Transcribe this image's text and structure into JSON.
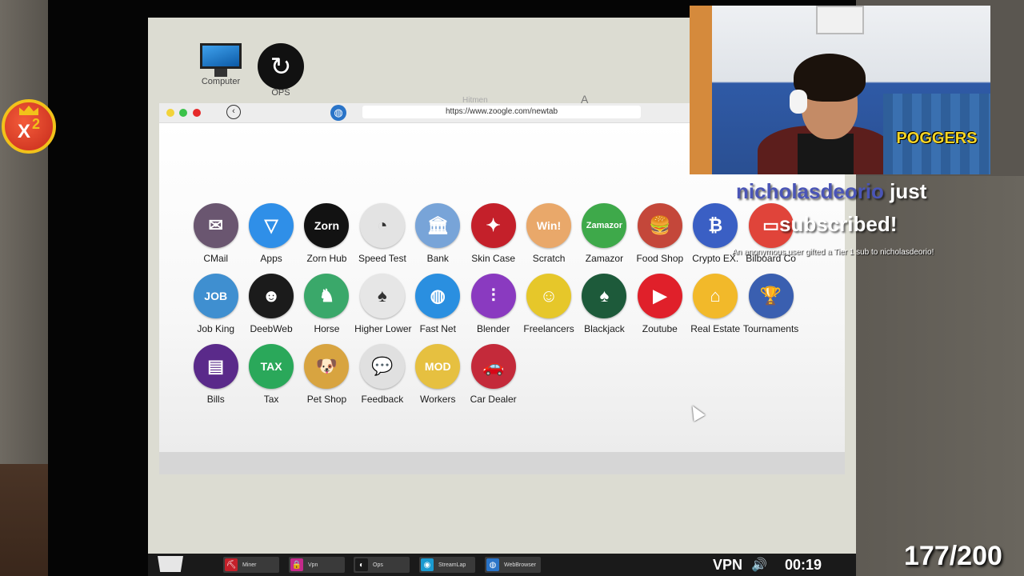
{
  "overlay": {
    "multiplier": {
      "symbol": "X",
      "value": "2"
    },
    "counter": "177/200",
    "alert": {
      "username": "nicholasdeorio",
      "line1_rest": "just",
      "line2": "subscribed!",
      "line3": "An anonymous user gifted a Tier 1 sub to nicholasdeorio!"
    },
    "webcam": {
      "sign": "POGGERS"
    }
  },
  "desktop": {
    "icons": [
      {
        "label": "Computer",
        "icon": "monitor-icon"
      },
      {
        "label": "OPS",
        "icon": "ops-icon"
      }
    ],
    "faded_labels": [
      "Hitmen",
      "A"
    ]
  },
  "browser": {
    "url": "https://www.zoogle.com/newtab",
    "back_glyph": "‹",
    "globe_glyph": "◍"
  },
  "apps": [
    {
      "label": "CMail",
      "bg": "#6a5670",
      "glyph": "✉"
    },
    {
      "label": "Apps",
      "bg": "#2f8fe8",
      "glyph": "▽"
    },
    {
      "label": "Zorn Hub",
      "bg": "#121212",
      "glyph": "Zorn"
    },
    {
      "label": "Speed Test",
      "bg": "#e3e3e3",
      "glyph": "◔"
    },
    {
      "label": "Bank",
      "bg": "#78a4d8",
      "glyph": "🏛"
    },
    {
      "label": "Skin Case",
      "bg": "#c4202a",
      "glyph": "✦"
    },
    {
      "label": "Scratch",
      "bg": "#e9a86a",
      "glyph": "Win!"
    },
    {
      "label": "Zamazor",
      "bg": "#3ea94a",
      "glyph": "Zamazor"
    },
    {
      "label": "Food Shop",
      "bg": "#c4473a",
      "glyph": "🍔"
    },
    {
      "label": "Crypto EX.",
      "bg": "#3a5fc4",
      "glyph": "₿"
    },
    {
      "label": "Bilboard Co",
      "bg": "#e0443a",
      "glyph": "▭"
    },
    {
      "label": "Job King",
      "bg": "#3f8fd0",
      "glyph": "JOB"
    },
    {
      "label": "DeebWeb",
      "bg": "#1b1b1b",
      "glyph": "☻"
    },
    {
      "label": "Horse",
      "bg": "#3aa86a",
      "glyph": "♞"
    },
    {
      "label": "Higher Lower",
      "bg": "#e6e6e6",
      "glyph": "♠"
    },
    {
      "label": "Fast Net",
      "bg": "#2a8fe0",
      "glyph": "◍"
    },
    {
      "label": "Blender",
      "bg": "#8a3ac0",
      "glyph": "⫶"
    },
    {
      "label": "Freelancers",
      "bg": "#e6c72a",
      "glyph": "☺"
    },
    {
      "label": "Blackjack",
      "bg": "#1d5a3a",
      "glyph": "♠"
    },
    {
      "label": "Zoutube",
      "bg": "#e0202a",
      "glyph": "▶"
    },
    {
      "label": "Real Estate",
      "bg": "#f2b92a",
      "glyph": "⌂"
    },
    {
      "label": "Tournaments",
      "bg": "#3a5fb0",
      "glyph": "🏆"
    },
    {
      "label": "Bills",
      "bg": "#5a2a8a",
      "glyph": "▤"
    },
    {
      "label": "Tax",
      "bg": "#2aa85a",
      "glyph": "TAX"
    },
    {
      "label": "Pet Shop",
      "bg": "#d8a440",
      "glyph": "🐶"
    },
    {
      "label": "Feedback",
      "bg": "#e0e0e0",
      "glyph": "💬"
    },
    {
      "label": "Workers",
      "bg": "#e6c040",
      "glyph": "MOD"
    },
    {
      "label": "Car Dealer",
      "bg": "#c42a3a",
      "glyph": "🚗"
    }
  ],
  "taskbar": {
    "items": [
      {
        "label": "Miner",
        "color": "#c4202a",
        "glyph": "⛏"
      },
      {
        "label": "Vpn",
        "color": "#c42a8a",
        "glyph": "🔒"
      },
      {
        "label": "Ops",
        "color": "#1b1b1b",
        "glyph": "◐"
      },
      {
        "label": "StreamLap",
        "color": "#1a9ad0",
        "glyph": "◉"
      },
      {
        "label": "WebBrowser",
        "color": "#2a74c8",
        "glyph": "◍"
      }
    ],
    "vpn": "VPN",
    "volume_glyph": "🔊",
    "clock": "00:19"
  }
}
